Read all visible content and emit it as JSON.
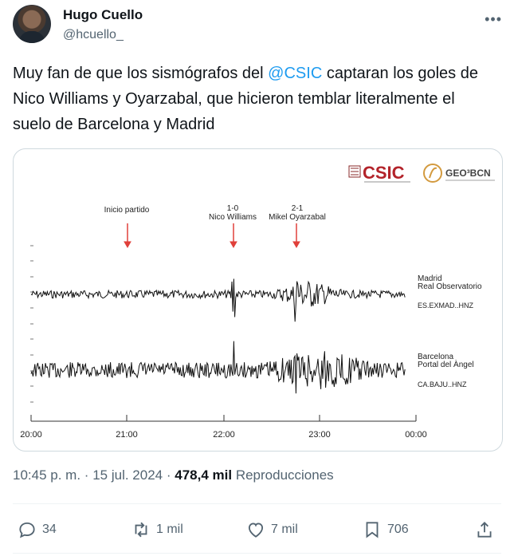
{
  "author": {
    "name": "Hugo Cuello",
    "handle": "@hcuello_"
  },
  "tweet": {
    "text_before": "Muy fan de que los sismógrafos del ",
    "mention": "@CSIC",
    "text_after": " captaran los goles de Nico Williams y Oyarzabal, que hicieron temblar literalmente el suelo de Barcelona y Madrid"
  },
  "figure": {
    "csic_logo": "CSIC",
    "geo_logo": "GEO³BCN",
    "events": [
      {
        "label": "Inicio partido",
        "sublabel": ""
      },
      {
        "label": "1-0",
        "sublabel": "Nico Williams"
      },
      {
        "label": "2-1",
        "sublabel": "Mikel Oyarzabal"
      }
    ],
    "stations": [
      {
        "name": "Madrid",
        "place": "Real Observatorio",
        "code": "ES.EXMAD..HNZ"
      },
      {
        "name": "Barcelona",
        "place": "Portal del Àngel",
        "code": "CA.BAJU..HNZ"
      }
    ],
    "time_ticks": [
      "20:00",
      "21:00",
      "22:00",
      "23:00",
      "00:00"
    ],
    "arrow_color": "#e0403a"
  },
  "meta": {
    "time": "10:45 p. m.",
    "sep1": "·",
    "date": "15 jul. 2024",
    "sep2": "·",
    "views": "478,4 mil",
    "views_label": "Reproducciones"
  },
  "actions": {
    "replies": "34",
    "retweets": "1 mil",
    "likes": "7 mil",
    "bookmarks": "706"
  },
  "icons": [
    "more-icon",
    "reply-icon",
    "retweet-icon",
    "like-icon",
    "bookmark-icon",
    "share-icon"
  ]
}
